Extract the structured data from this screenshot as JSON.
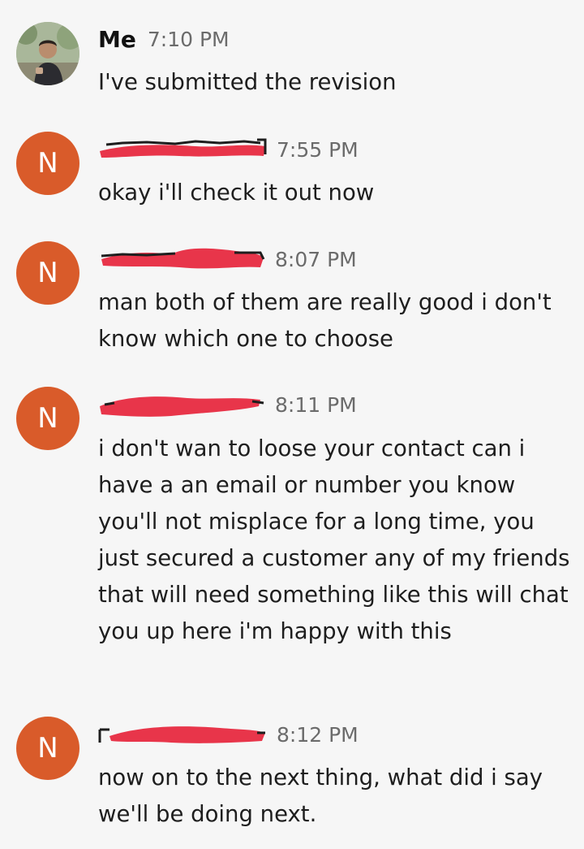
{
  "messages": [
    {
      "sender": "Me",
      "avatar": "photo",
      "time": "7:10 PM",
      "text": "I've submitted the revision"
    },
    {
      "sender": "",
      "avatar": "N",
      "time": "7:55 PM",
      "text": "okay i'll check it out now"
    },
    {
      "sender": "",
      "avatar": "N",
      "time": "8:07 PM",
      "text": "man both of them are really good i don't know which one to choose"
    },
    {
      "sender": "",
      "avatar": "N",
      "time": "8:11 PM",
      "text": "i don't wan to loose your contact can i have a an email or number you know you'll not misplace for a long time, you just secured a customer any of my friends that will need something like this will chat you up here i'm happy with this"
    },
    {
      "sender": "",
      "avatar": "N",
      "time": "8:12 PM",
      "text": "now on to the next thing, what did i say we'll be doing next."
    }
  ],
  "colors": {
    "background": "#f6f6f6",
    "avatar_bg": "#d95b2a",
    "redaction": "#e8354a",
    "timestamp": "#6b6b6b"
  },
  "icons": {
    "profile_photo": "user-photo-avatar"
  }
}
